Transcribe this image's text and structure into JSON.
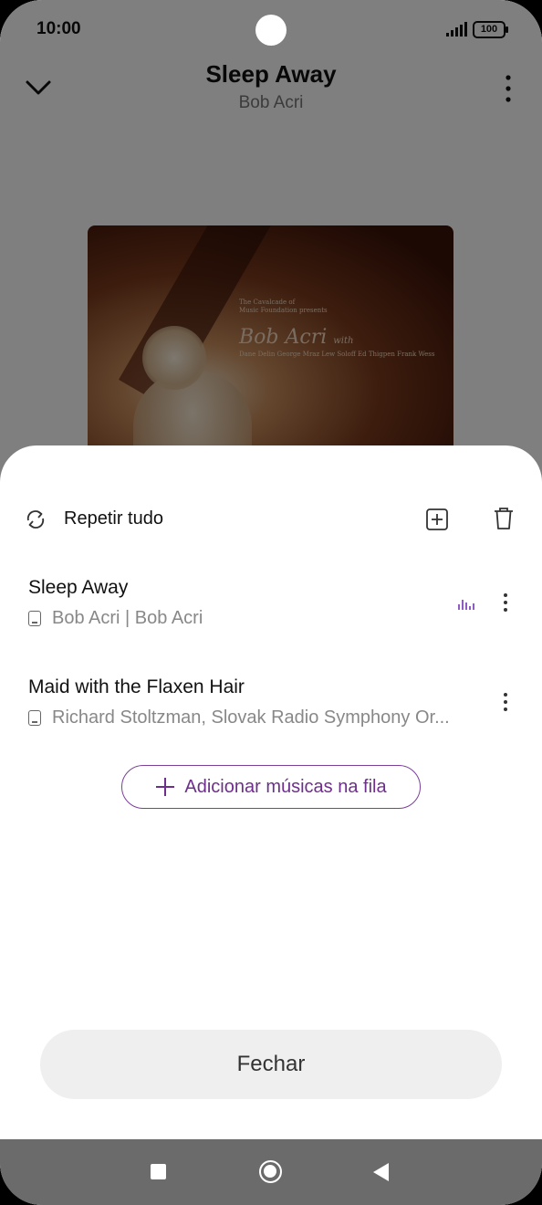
{
  "status_bar": {
    "time": "10:00",
    "battery": "100"
  },
  "player": {
    "title": "Sleep Away",
    "artist": "Bob Acri",
    "album_art": {
      "line1": "The Cavalcade of",
      "line2": "Music Foundation presents",
      "name": "Bob Acri",
      "with": "with",
      "names": "Dane Delin George Mraz Lew Soloff Ed Thigpen Frank Wess"
    }
  },
  "sheet": {
    "repeat_label": "Repetir tudo",
    "queue": [
      {
        "title": "Sleep Away",
        "subtitle": "Bob Acri | Bob Acri",
        "playing": true
      },
      {
        "title": "Maid with the Flaxen Hair",
        "subtitle": "Richard Stoltzman, Slovak Radio Symphony Or...",
        "playing": false
      }
    ],
    "add_songs_label": "Adicionar músicas na fila",
    "close_label": "Fechar"
  },
  "colors": {
    "accent": "#7c3f9a",
    "eq": "#8e5cc4"
  }
}
